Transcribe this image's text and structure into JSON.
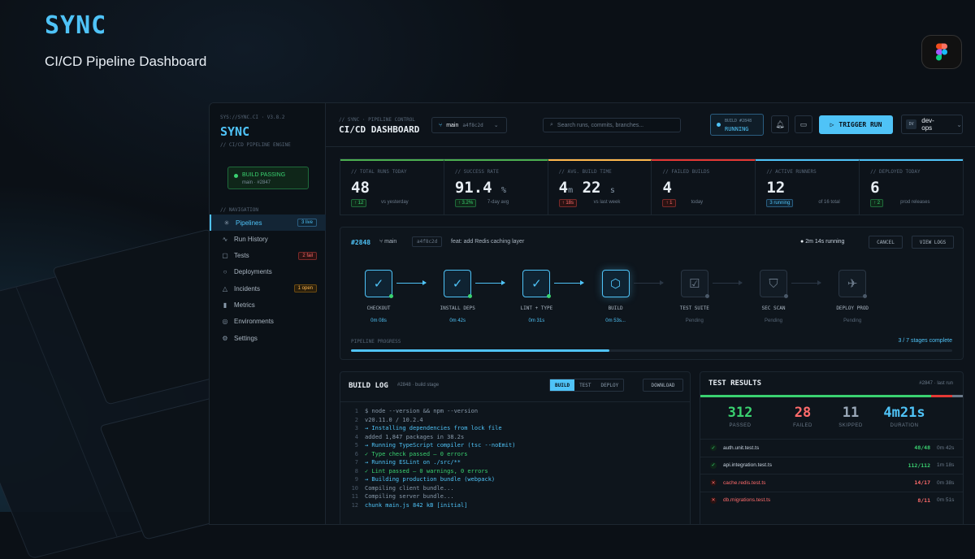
{
  "brand": "SYNC",
  "subtitle": "CI/CD Pipeline Dashboard",
  "colors": {
    "accent": "#4fc3f7",
    "success": "#3ad170",
    "danger": "#ff6b6b",
    "warning": "#ffb74d"
  },
  "sidebar": {
    "version": "SYS://SYNC.CI · V3.8.2",
    "brand": "SYNC",
    "tagline": "// CI/CD PIPELINE ENGINE",
    "status": {
      "label": "BUILD PASSING",
      "detail": "main · #2847"
    },
    "nav_heading": "// NAVIGATION",
    "items": [
      {
        "label": "Pipelines",
        "icon": "pipelines-icon",
        "glyph": "✳",
        "badge": "3 live",
        "badge_type": "blue",
        "active": true
      },
      {
        "label": "Run History",
        "icon": "activity-icon",
        "glyph": "∿",
        "badge": "",
        "badge_type": ""
      },
      {
        "label": "Tests",
        "icon": "tests-icon",
        "glyph": "▢",
        "badge": "2 fail",
        "badge_type": "red"
      },
      {
        "label": "Deployments",
        "icon": "deploy-icon",
        "glyph": "○",
        "badge": "",
        "badge_type": ""
      },
      {
        "label": "Incidents",
        "icon": "alert-icon",
        "glyph": "△",
        "badge": "1 open",
        "badge_type": "amber"
      },
      {
        "label": "Metrics",
        "icon": "metrics-icon",
        "glyph": "▮",
        "badge": "",
        "badge_type": ""
      },
      {
        "label": "Environments",
        "icon": "globe-icon",
        "glyph": "◎",
        "badge": "",
        "badge_type": ""
      },
      {
        "label": "Settings",
        "icon": "gear-icon",
        "glyph": "⚙",
        "badge": "",
        "badge_type": ""
      }
    ]
  },
  "header": {
    "crumb": "// SYNC · PIPELINE CONTROL",
    "title": "CI/CD DASHBOARD",
    "branch": "main",
    "commit": "a4f8c2d",
    "search_placeholder": "Search runs, commits, branches...",
    "build_label": "BUILD #2848",
    "build_status": "RUNNING",
    "trigger": "TRIGGER RUN",
    "user_initials": "DV",
    "user": "dev-ops"
  },
  "stats": [
    {
      "label": "// TOTAL RUNS TODAY",
      "value": "48",
      "change": "↑ 12",
      "type": "g",
      "caption": "vs yesterday",
      "color": "#4caf50"
    },
    {
      "label": "// SUCCESS RATE",
      "value": "91.4",
      "unit": "%",
      "change": "↑ 3.2%",
      "type": "g",
      "caption": "7-day avg",
      "color": "#4caf50"
    },
    {
      "label": "// AVG. BUILD TIME",
      "value": "4m 22s",
      "change": "↑ 18s",
      "type": "r",
      "caption": "vs last week",
      "color": "#ffb74d"
    },
    {
      "label": "// FAILED BUILDS",
      "value": "4",
      "change": "↑ 1",
      "type": "r",
      "caption": "today",
      "color": "#e53935"
    },
    {
      "label": "// ACTIVE RUNNERS",
      "value": "12",
      "change": "3 running",
      "type": "b",
      "caption": "of 16 total",
      "color": "#4fc3f7"
    },
    {
      "label": "// DEPLOYED TODAY",
      "value": "6",
      "change": "↑ 2",
      "type": "g",
      "caption": "prod releases",
      "color": "#4fc3f7"
    }
  ],
  "pipeline": {
    "id": "#2848",
    "branch": "main",
    "commit": "a4f8c2d",
    "message": "feat: add Redis caching layer",
    "running": "2m 14s running",
    "cancel": "CANCEL",
    "view_logs": "VIEW LOGS",
    "stages": [
      {
        "name": "CHECKOUT",
        "time": "0m 08s",
        "state": "done",
        "glyph": "✓",
        "icon": "check-icon"
      },
      {
        "name": "INSTALL DEPS",
        "time": "0m 42s",
        "state": "done",
        "glyph": "✓",
        "icon": "check-icon"
      },
      {
        "name": "LINT + TYPE",
        "time": "0m 31s",
        "state": "done",
        "glyph": "✓",
        "icon": "check-icon"
      },
      {
        "name": "BUILD",
        "time": "0m 53s...",
        "state": "run",
        "glyph": "⬡",
        "icon": "hexagon-icon"
      },
      {
        "name": "TEST SUITE",
        "time": "Pending",
        "state": "pend",
        "glyph": "☑",
        "icon": "checklist-icon"
      },
      {
        "name": "SEC SCAN",
        "time": "Pending",
        "state": "pend",
        "glyph": "⛉",
        "icon": "shield-icon"
      },
      {
        "name": "DEPLOY PROD",
        "time": "Pending",
        "state": "pend",
        "glyph": "✈",
        "icon": "rocket-icon"
      }
    ],
    "progress_label": "PIPELINE PROGRESS",
    "progress_text": "3 / 7 stages complete",
    "progress": 0.43
  },
  "log": {
    "title": "BUILD LOG",
    "sub": "#2848 · build stage",
    "tabs": [
      "BUILD",
      "TEST",
      "DEPLOY"
    ],
    "download": "DOWNLOAD",
    "lines": [
      {
        "n": "1",
        "text": "$ node --version && npm --version",
        "kind": ""
      },
      {
        "n": "2",
        "text": "v20.11.0 / 10.2.4",
        "kind": ""
      },
      {
        "n": "3",
        "text": "→ Installing dependencies from lock file",
        "kind": "info"
      },
      {
        "n": "4",
        "text": "added 1,847 packages in 38.2s",
        "kind": ""
      },
      {
        "n": "5",
        "text": "→ Running TypeScript compiler (tsc --noEmit)",
        "kind": "info"
      },
      {
        "n": "6",
        "text": "✓ Type check passed — 0 errors",
        "kind": "ok"
      },
      {
        "n": "7",
        "text": "→ Running ESLint on ./src/**",
        "kind": "info"
      },
      {
        "n": "8",
        "text": "✓ Lint passed — 0 warnings, 0 errors",
        "kind": "ok"
      },
      {
        "n": "9",
        "text": "→ Building production bundle (webpack)",
        "kind": "info"
      },
      {
        "n": "10",
        "text": "Compiling client bundle...",
        "kind": ""
      },
      {
        "n": "11",
        "text": "Compiling server bundle...",
        "kind": ""
      },
      {
        "n": "12",
        "text": "chunk main.js 842 kB [initial]",
        "kind": "info"
      }
    ]
  },
  "tests": {
    "title": "TEST RESULTS",
    "sub": "#2847 · last run",
    "summary": [
      {
        "value": "312",
        "label": "PASSED",
        "color": "#3ad170"
      },
      {
        "value": "28",
        "label": "FAILED",
        "color": "#ff6b6b"
      },
      {
        "value": "11",
        "label": "SKIPPED",
        "color": "#9aa8b8"
      },
      {
        "value": "4m21s",
        "label": "DURATION",
        "color": "#4fc3f7"
      }
    ],
    "ratio": {
      "passed": 0.88,
      "failed": 0.08,
      "skipped": 0.04
    },
    "rows": [
      {
        "name": "auth.unit.test.ts",
        "count": "48/48",
        "dur": "0m 42s",
        "ok": true
      },
      {
        "name": "api.integration.test.ts",
        "count": "112/112",
        "dur": "1m 18s",
        "ok": true
      },
      {
        "name": "cache.redis.test.ts",
        "count": "14/17",
        "dur": "0m 38s",
        "ok": false
      },
      {
        "name": "db.migrations.test.ts",
        "count": "8/11",
        "dur": "0m 51s",
        "ok": false
      }
    ]
  }
}
